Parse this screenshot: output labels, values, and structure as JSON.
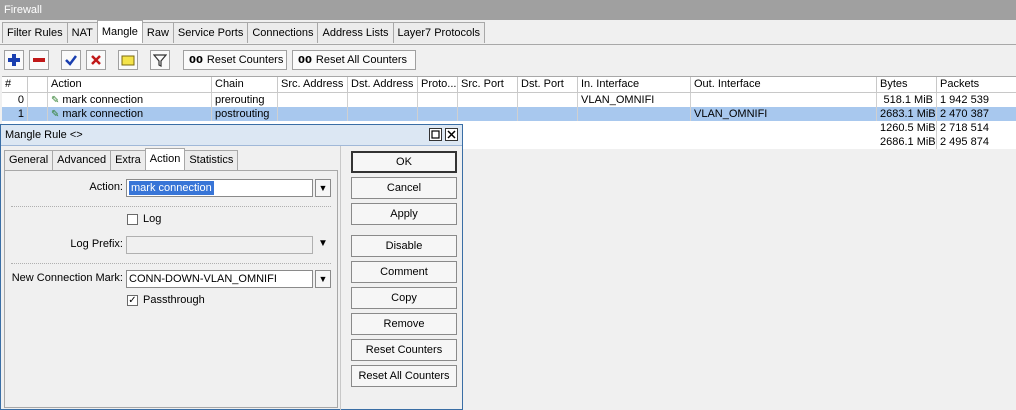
{
  "window": {
    "title": "Firewall"
  },
  "tabs": [
    "Filter Rules",
    "NAT",
    "Mangle",
    "Raw",
    "Service Ports",
    "Connections",
    "Address Lists",
    "Layer7 Protocols"
  ],
  "toolbar": {
    "reset_counters": "Reset Counters",
    "reset_all_counters": "Reset All Counters",
    "counter_prefix": "00"
  },
  "table": {
    "columns": [
      "#",
      "Action",
      "Chain",
      "Src. Address",
      "Dst. Address",
      "Proto...",
      "Src. Port",
      "Dst. Port",
      "In. Interface",
      "Out. Interface",
      "Bytes",
      "Packets"
    ],
    "rows": [
      {
        "num": "0",
        "action": "mark connection",
        "chain": "prerouting",
        "in_interface": "VLAN_OMNIFI",
        "out_interface": "",
        "bytes": "518.1 MiB",
        "packets": "1 942 539"
      },
      {
        "num": "1",
        "action": "mark connection",
        "chain": "postrouting",
        "in_interface": "",
        "out_interface": "VLAN_OMNIFI",
        "bytes": "2683.1 MiB",
        "packets": "2 470 387"
      },
      {
        "num": "",
        "action": "",
        "chain": "",
        "in_interface": "",
        "out_interface": "",
        "bytes": "1260.5 MiB",
        "packets": "2 718 514"
      },
      {
        "num": "",
        "action": "",
        "chain": "",
        "in_interface": "",
        "out_interface": "",
        "bytes": "2686.1 MiB",
        "packets": "2 495 874"
      }
    ]
  },
  "dialog": {
    "title": "Mangle Rule <>",
    "tabs": [
      "General",
      "Advanced",
      "Extra",
      "Action",
      "Statistics"
    ],
    "action_label": "Action:",
    "action_value": "mark connection",
    "log_label": "Log",
    "log_prefix_label": "Log Prefix:",
    "new_conn_mark_label": "New Connection Mark:",
    "new_conn_mark_value": "CONN-DOWN-VLAN_OMNIFI",
    "passthrough_label": "Passthrough",
    "buttons": [
      "OK",
      "Cancel",
      "Apply",
      "Disable",
      "Comment",
      "Copy",
      "Remove",
      "Reset Counters",
      "Reset All Counters"
    ]
  },
  "colors": {
    "selected_row": "#a8c8ee",
    "accent_blue": "#3875d7"
  }
}
